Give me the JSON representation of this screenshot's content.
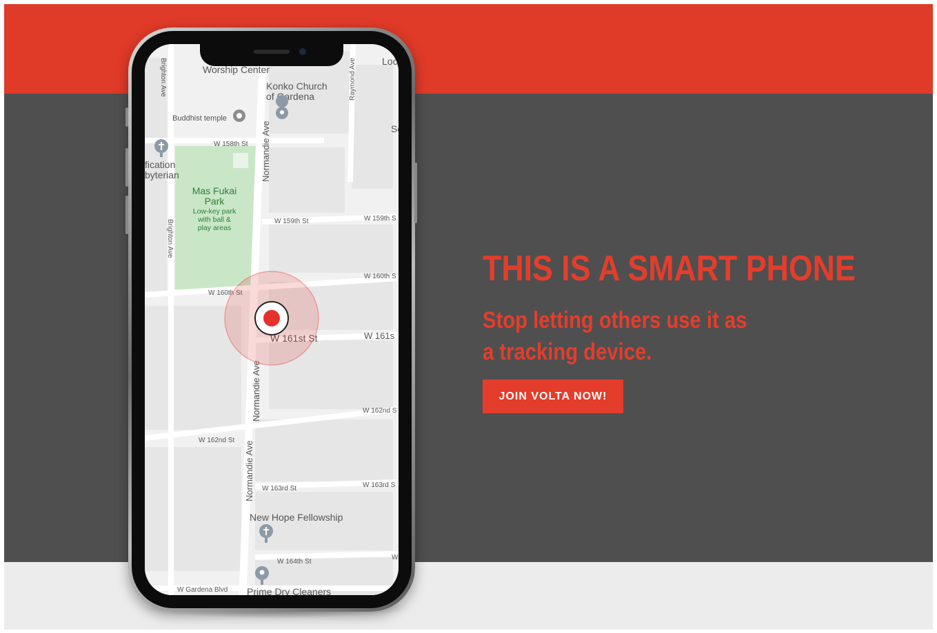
{
  "colors": {
    "brand_red": "#e43d2c",
    "band_red": "#e03a28",
    "band_dark": "#4f4f4f",
    "band_light": "#ececec",
    "park_green": "#c9e7c7",
    "location_red": "#e5312b"
  },
  "hero": {
    "title": "THIS IS A SMART PHONE",
    "subtitle": "Stop letting others use it as a tracking device.",
    "cta_label": "JOIN VOLTA NOW!"
  },
  "map": {
    "places": {
      "worship_center": "Worship Center",
      "konko_church": "Konko Church",
      "konko_church_line2": "of Gardena",
      "buddhist_temple": "Buddhist temple",
      "fication": "fication",
      "byterian": "byterian",
      "park_name": "Mas Fukai",
      "park_name_line2": "Park",
      "park_desc_1": "Low-key park",
      "park_desc_2": "with ball &",
      "park_desc_3": "play areas",
      "new_hope": "New Hope Fellowship",
      "prime_dry": "Prime Dry Cleaners",
      "loc_edge": "Loc",
      "s_edge": "Sc"
    },
    "streets": {
      "w158": "W 158th St",
      "w159": "W 159th St",
      "w159_right": "W 159th S",
      "w160": "W 160th St",
      "w160_right": "W 160th S",
      "w161": "W 161st St",
      "w161_right": "W 161s",
      "w162": "W 162nd St",
      "w162_right": "W 162nd S",
      "w163": "W 163rd St",
      "w163_right": "W 163rd S",
      "w164": "W 164th St",
      "w164_right": "W",
      "gardena": "W Gardena Blvd",
      "normandie": "Normandie Ave",
      "brighton": "Brighton Ave",
      "raymond": "Raymond Ave"
    }
  }
}
